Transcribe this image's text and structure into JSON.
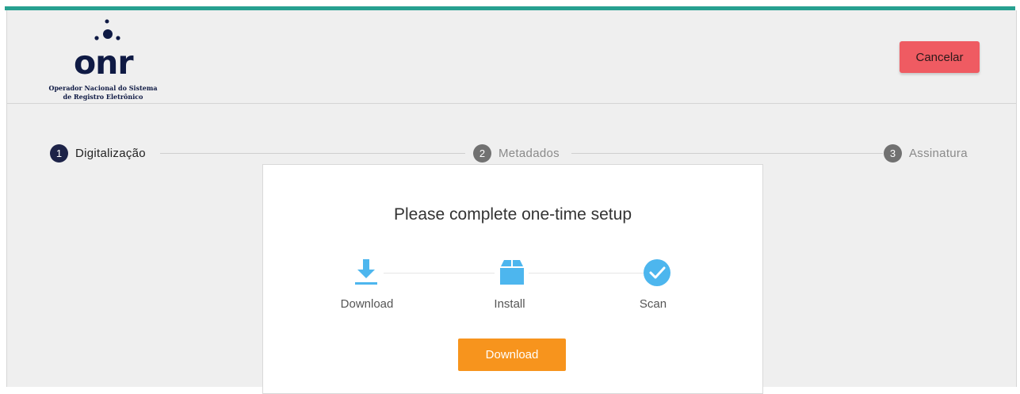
{
  "header": {
    "logo": {
      "wordmark": "onr",
      "line1": "Operador Nacional do Sistema",
      "line2": "de Registro Eletrônico"
    },
    "cancel_label": "Cancelar"
  },
  "stepper": {
    "steps": [
      {
        "number": "1",
        "label": "Digitalização",
        "state": "active"
      },
      {
        "number": "2",
        "label": "Metadados",
        "state": "inactive"
      },
      {
        "number": "3",
        "label": "Assinatura",
        "state": "inactive"
      }
    ]
  },
  "setup_dialog": {
    "title": "Please complete one-time setup",
    "steps": [
      {
        "icon": "download-icon",
        "label": "Download"
      },
      {
        "icon": "package-icon",
        "label": "Install"
      },
      {
        "icon": "check-circle-icon",
        "label": "Scan"
      }
    ],
    "download_label": "Download"
  },
  "colors": {
    "accent_top": "#27a090",
    "cancel": "#ef5b62",
    "download": "#f7941d",
    "step_active": "#1d2348",
    "step_inactive": "#717171",
    "setup_icon": "#4db6ee"
  }
}
